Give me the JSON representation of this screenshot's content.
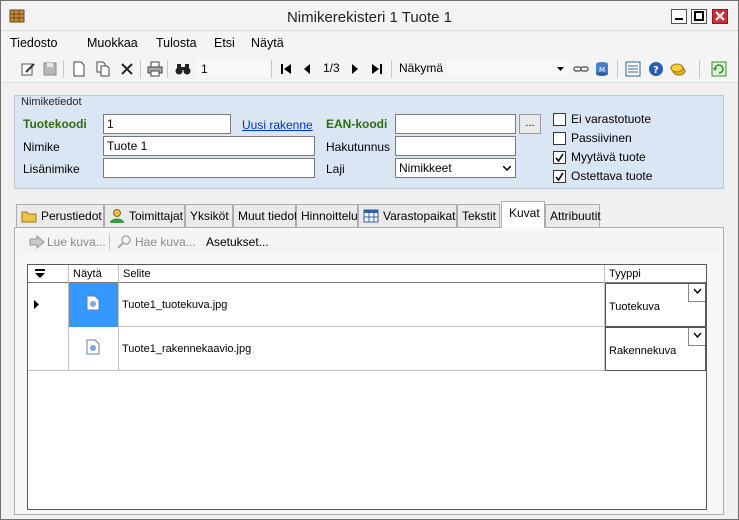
{
  "window": {
    "title": "Nimikerekisteri 1 Tuote 1"
  },
  "menu": [
    "Tiedosto",
    "Muokkaa",
    "Tulosta",
    "Etsi",
    "Näytä"
  ],
  "toolbar": {
    "search_value": "1",
    "record_position": "1/3",
    "view_label": "Näkymä"
  },
  "header": {
    "caption": "Nimiketiedot",
    "tuotekoodi_label": "Tuotekoodi",
    "tuotekoodi_value": "1",
    "uusi_rakenne_link": "Uusi rakenne",
    "nimike_label": "Nimike",
    "nimike_value": "Tuote 1",
    "lisanimike_label": "Lisänimike",
    "lisanimike_value": "",
    "ean_label": "EAN-koodi",
    "ean_value": "",
    "ean_browse": "...",
    "hakutunnus_label": "Hakutunnus",
    "hakutunnus_value": "",
    "laji_label": "Laji",
    "laji_value": "Nimikkeet",
    "checkboxes": [
      {
        "label": "Ei varastotuote",
        "checked": false
      },
      {
        "label": "Passiivinen",
        "checked": false
      },
      {
        "label": "Myytävä tuote",
        "checked": true
      },
      {
        "label": "Ostettava tuote",
        "checked": true
      }
    ]
  },
  "tabs": [
    {
      "label": "Perustiedot",
      "icon": "folder-icon"
    },
    {
      "label": "Toimittajat",
      "icon": "person-icon"
    },
    {
      "label": "Yksiköt"
    },
    {
      "label": "Muut tiedot"
    },
    {
      "label": "Hinnoittelu"
    },
    {
      "label": "Varastopaikat",
      "icon": "table-icon"
    },
    {
      "label": "Tekstit"
    },
    {
      "label": "Kuvat",
      "active": true
    },
    {
      "label": "Attribuutit"
    }
  ],
  "kuvat_toolbar": {
    "lue_kuva": "Lue kuva...",
    "hae_kuva": "Hae kuva...",
    "asetukset": "Asetukset..."
  },
  "grid": {
    "columns": [
      "Näytä",
      "Selite",
      "Tyyppi"
    ],
    "rows": [
      {
        "selite": "Tuote1_tuotekuva.jpg",
        "tyyppi": "Tuotekuva",
        "selected": true
      },
      {
        "selite": "Tuote1_rakennekaavio.jpg",
        "tyyppi": "Rakennekuva",
        "selected": false
      }
    ]
  },
  "colors": {
    "group_bg": "#dbe6f5",
    "label_green": "#2f6c0e",
    "selection_blue": "#3399ff",
    "link_blue": "#0033cc"
  }
}
